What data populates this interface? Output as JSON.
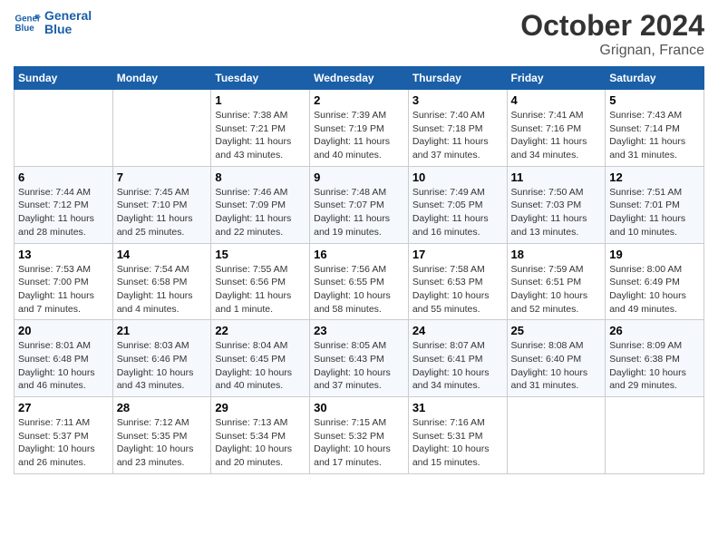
{
  "logo": {
    "line1": "General",
    "line2": "Blue"
  },
  "title": "October 2024",
  "location": "Grignan, France",
  "weekdays": [
    "Sunday",
    "Monday",
    "Tuesday",
    "Wednesday",
    "Thursday",
    "Friday",
    "Saturday"
  ],
  "weeks": [
    [
      {
        "day": "",
        "detail": ""
      },
      {
        "day": "",
        "detail": ""
      },
      {
        "day": "1",
        "detail": "Sunrise: 7:38 AM\nSunset: 7:21 PM\nDaylight: 11 hours and 43 minutes."
      },
      {
        "day": "2",
        "detail": "Sunrise: 7:39 AM\nSunset: 7:19 PM\nDaylight: 11 hours and 40 minutes."
      },
      {
        "day": "3",
        "detail": "Sunrise: 7:40 AM\nSunset: 7:18 PM\nDaylight: 11 hours and 37 minutes."
      },
      {
        "day": "4",
        "detail": "Sunrise: 7:41 AM\nSunset: 7:16 PM\nDaylight: 11 hours and 34 minutes."
      },
      {
        "day": "5",
        "detail": "Sunrise: 7:43 AM\nSunset: 7:14 PM\nDaylight: 11 hours and 31 minutes."
      }
    ],
    [
      {
        "day": "6",
        "detail": "Sunrise: 7:44 AM\nSunset: 7:12 PM\nDaylight: 11 hours and 28 minutes."
      },
      {
        "day": "7",
        "detail": "Sunrise: 7:45 AM\nSunset: 7:10 PM\nDaylight: 11 hours and 25 minutes."
      },
      {
        "day": "8",
        "detail": "Sunrise: 7:46 AM\nSunset: 7:09 PM\nDaylight: 11 hours and 22 minutes."
      },
      {
        "day": "9",
        "detail": "Sunrise: 7:48 AM\nSunset: 7:07 PM\nDaylight: 11 hours and 19 minutes."
      },
      {
        "day": "10",
        "detail": "Sunrise: 7:49 AM\nSunset: 7:05 PM\nDaylight: 11 hours and 16 minutes."
      },
      {
        "day": "11",
        "detail": "Sunrise: 7:50 AM\nSunset: 7:03 PM\nDaylight: 11 hours and 13 minutes."
      },
      {
        "day": "12",
        "detail": "Sunrise: 7:51 AM\nSunset: 7:01 PM\nDaylight: 11 hours and 10 minutes."
      }
    ],
    [
      {
        "day": "13",
        "detail": "Sunrise: 7:53 AM\nSunset: 7:00 PM\nDaylight: 11 hours and 7 minutes."
      },
      {
        "day": "14",
        "detail": "Sunrise: 7:54 AM\nSunset: 6:58 PM\nDaylight: 11 hours and 4 minutes."
      },
      {
        "day": "15",
        "detail": "Sunrise: 7:55 AM\nSunset: 6:56 PM\nDaylight: 11 hours and 1 minute."
      },
      {
        "day": "16",
        "detail": "Sunrise: 7:56 AM\nSunset: 6:55 PM\nDaylight: 10 hours and 58 minutes."
      },
      {
        "day": "17",
        "detail": "Sunrise: 7:58 AM\nSunset: 6:53 PM\nDaylight: 10 hours and 55 minutes."
      },
      {
        "day": "18",
        "detail": "Sunrise: 7:59 AM\nSunset: 6:51 PM\nDaylight: 10 hours and 52 minutes."
      },
      {
        "day": "19",
        "detail": "Sunrise: 8:00 AM\nSunset: 6:49 PM\nDaylight: 10 hours and 49 minutes."
      }
    ],
    [
      {
        "day": "20",
        "detail": "Sunrise: 8:01 AM\nSunset: 6:48 PM\nDaylight: 10 hours and 46 minutes."
      },
      {
        "day": "21",
        "detail": "Sunrise: 8:03 AM\nSunset: 6:46 PM\nDaylight: 10 hours and 43 minutes."
      },
      {
        "day": "22",
        "detail": "Sunrise: 8:04 AM\nSunset: 6:45 PM\nDaylight: 10 hours and 40 minutes."
      },
      {
        "day": "23",
        "detail": "Sunrise: 8:05 AM\nSunset: 6:43 PM\nDaylight: 10 hours and 37 minutes."
      },
      {
        "day": "24",
        "detail": "Sunrise: 8:07 AM\nSunset: 6:41 PM\nDaylight: 10 hours and 34 minutes."
      },
      {
        "day": "25",
        "detail": "Sunrise: 8:08 AM\nSunset: 6:40 PM\nDaylight: 10 hours and 31 minutes."
      },
      {
        "day": "26",
        "detail": "Sunrise: 8:09 AM\nSunset: 6:38 PM\nDaylight: 10 hours and 29 minutes."
      }
    ],
    [
      {
        "day": "27",
        "detail": "Sunrise: 7:11 AM\nSunset: 5:37 PM\nDaylight: 10 hours and 26 minutes."
      },
      {
        "day": "28",
        "detail": "Sunrise: 7:12 AM\nSunset: 5:35 PM\nDaylight: 10 hours and 23 minutes."
      },
      {
        "day": "29",
        "detail": "Sunrise: 7:13 AM\nSunset: 5:34 PM\nDaylight: 10 hours and 20 minutes."
      },
      {
        "day": "30",
        "detail": "Sunrise: 7:15 AM\nSunset: 5:32 PM\nDaylight: 10 hours and 17 minutes."
      },
      {
        "day": "31",
        "detail": "Sunrise: 7:16 AM\nSunset: 5:31 PM\nDaylight: 10 hours and 15 minutes."
      },
      {
        "day": "",
        "detail": ""
      },
      {
        "day": "",
        "detail": ""
      }
    ]
  ]
}
